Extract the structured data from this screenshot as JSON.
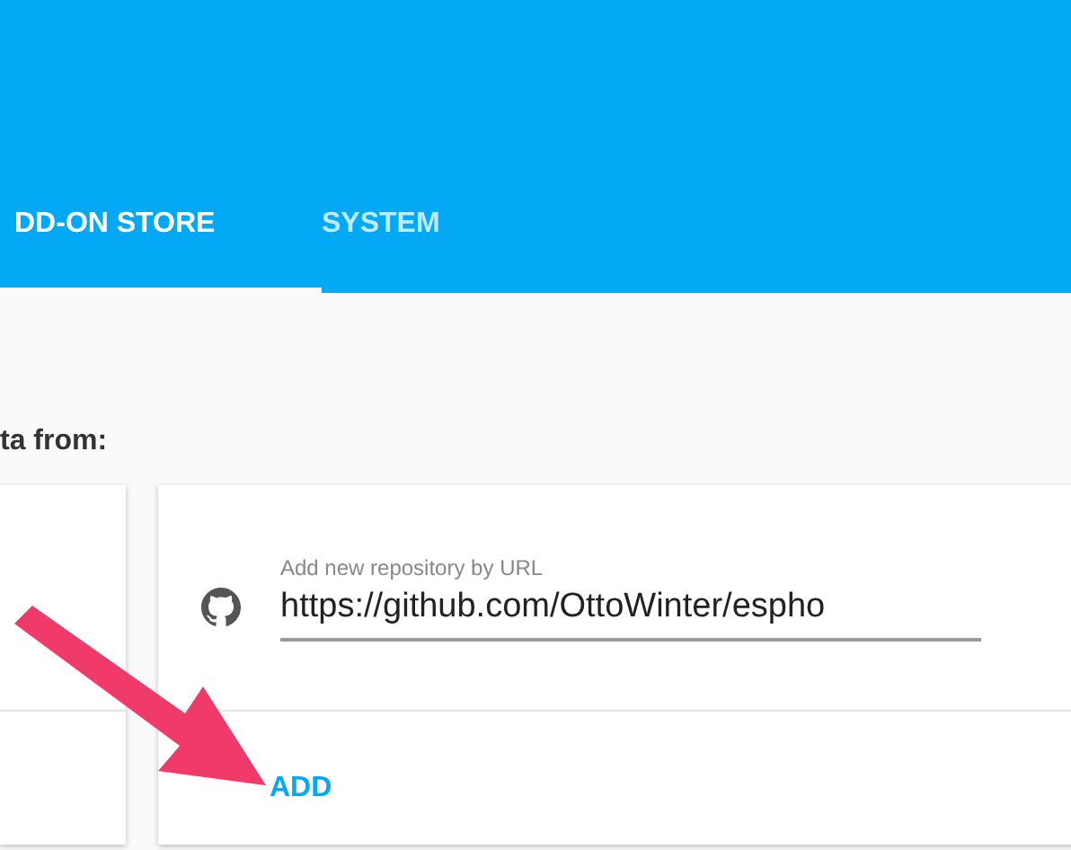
{
  "tabs": [
    {
      "label": "DD-ON STORE",
      "selected": true
    },
    {
      "label": "SYSTEM",
      "selected": false
    }
  ],
  "intro": "ta from:",
  "repository": {
    "label": "Add new repository by URL",
    "value": "https://github.com/OttoWinter/espho"
  },
  "add_button": "ADD"
}
